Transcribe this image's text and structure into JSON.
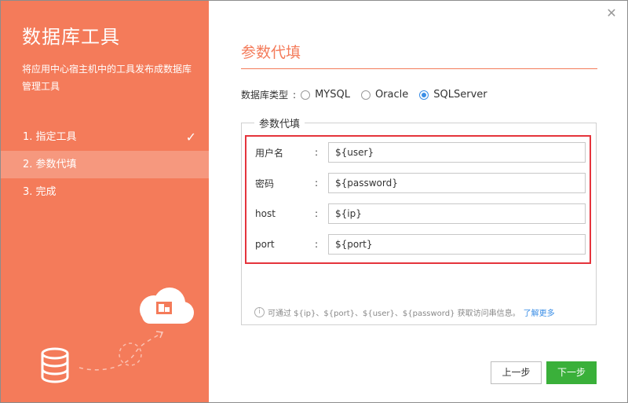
{
  "sidebar": {
    "title": "数据库工具",
    "description": "将应用中心宿主机中的工具发布成数据库管理工具",
    "steps": [
      {
        "label": "1. 指定工具",
        "done": true
      },
      {
        "label": "2. 参数代填",
        "active": true
      },
      {
        "label": "3. 完成"
      }
    ],
    "check_icon": "✓"
  },
  "main": {
    "title": "参数代填",
    "db_type_label": "数据库类型",
    "db_type_colon": ":",
    "db_types": [
      "MYSQL",
      "Oracle",
      "SQLServer"
    ],
    "db_type_selected": "SQLServer",
    "group_title": "参数代填",
    "fields": [
      {
        "label": "用户名",
        "colon": ":",
        "value": "${user}"
      },
      {
        "label": "密码",
        "colon": ":",
        "value": "${password}"
      },
      {
        "label": "host",
        "colon": ":",
        "value": "${ip}"
      },
      {
        "label": "port",
        "colon": ":",
        "value": "${port}"
      }
    ],
    "hint_text": "可通过 ${ip}、${port}、${user}、${password} 获取访问串信息。",
    "hint_link": "了解更多"
  },
  "buttons": {
    "prev": "上一步",
    "next": "下一步"
  },
  "colors": {
    "accent": "#f47b5a",
    "primary_button": "#3ab03a",
    "highlight": "#e5343c",
    "link": "#3a8ee6"
  }
}
